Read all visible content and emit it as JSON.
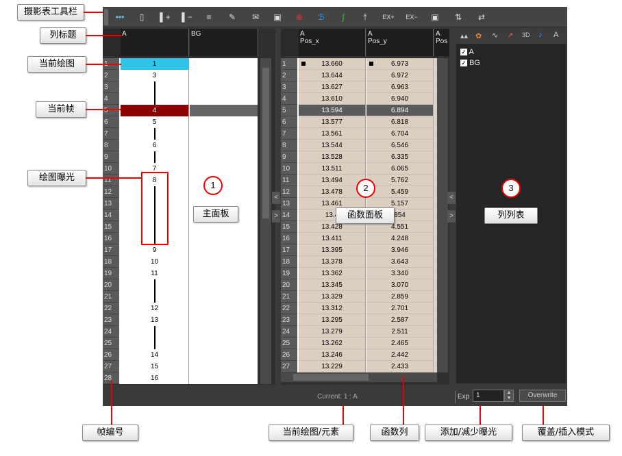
{
  "toolbar": {
    "icons": [
      "more-icon",
      "panel-toggle-icon",
      "add-column-icon",
      "delete-column-icon",
      "insert-frame-icon",
      "edit-drawing-icon",
      "new-drawing-icon",
      "duplicate-icon",
      "target-icon",
      "bezier-icon",
      "ease-icon",
      "stop-motion-icon",
      "ex-plus",
      "ex-minus",
      "text-icon",
      "swap-icon",
      "flip-icon"
    ],
    "ex_plus": "EX+",
    "ex_minus": "EX−"
  },
  "main_panel": {
    "col_a": "A",
    "col_bg": "BG",
    "rows": [
      {
        "n": "1",
        "v": "1"
      },
      {
        "n": "2",
        "v": "3"
      },
      {
        "n": "3",
        "v": ""
      },
      {
        "n": "4",
        "v": ""
      },
      {
        "n": "5",
        "v": "4"
      },
      {
        "n": "6",
        "v": "5"
      },
      {
        "n": "7",
        "v": ""
      },
      {
        "n": "8",
        "v": "6"
      },
      {
        "n": "9",
        "v": ""
      },
      {
        "n": "10",
        "v": "7"
      },
      {
        "n": "11",
        "v": "8"
      },
      {
        "n": "12",
        "v": ""
      },
      {
        "n": "13",
        "v": ""
      },
      {
        "n": "14",
        "v": ""
      },
      {
        "n": "15",
        "v": ""
      },
      {
        "n": "16",
        "v": ""
      },
      {
        "n": "17",
        "v": "9"
      },
      {
        "n": "18",
        "v": "10"
      },
      {
        "n": "19",
        "v": "11"
      },
      {
        "n": "20",
        "v": ""
      },
      {
        "n": "21",
        "v": ""
      },
      {
        "n": "22",
        "v": "12"
      },
      {
        "n": "23",
        "v": "13"
      },
      {
        "n": "24",
        "v": ""
      },
      {
        "n": "25",
        "v": ""
      },
      {
        "n": "26",
        "v": "14"
      },
      {
        "n": "27",
        "v": "15"
      },
      {
        "n": "28",
        "v": "16"
      }
    ]
  },
  "function_panel": {
    "col1_title": "A",
    "col1_sub": "Pos_x",
    "col2_title": "A",
    "col2_sub": "Pos_y",
    "col3_title": "A",
    "col3_sub": "Pos",
    "rows": [
      {
        "n": "1",
        "x": "13.660",
        "y": "6.973"
      },
      {
        "n": "2",
        "x": "13.644",
        "y": "6.972"
      },
      {
        "n": "3",
        "x": "13.627",
        "y": "6.963"
      },
      {
        "n": "4",
        "x": "13.610",
        "y": "6.940"
      },
      {
        "n": "5",
        "x": "13.594",
        "y": "6.894"
      },
      {
        "n": "6",
        "x": "13.577",
        "y": "6.818"
      },
      {
        "n": "7",
        "x": "13.561",
        "y": "6.704"
      },
      {
        "n": "8",
        "x": "13.544",
        "y": "6.546"
      },
      {
        "n": "9",
        "x": "13.528",
        "y": "6.335"
      },
      {
        "n": "10",
        "x": "13.511",
        "y": "6.065"
      },
      {
        "n": "11",
        "x": "13.494",
        "y": "5.762"
      },
      {
        "n": "12",
        "x": "13.478",
        "y": "5.459"
      },
      {
        "n": "13",
        "x": "13.461",
        "y": "5.157"
      },
      {
        "n": "14",
        "x": "13.4",
        "y": "854"
      },
      {
        "n": "15",
        "x": "13.428",
        "y": "4.551"
      },
      {
        "n": "16",
        "x": "13.411",
        "y": "4.248"
      },
      {
        "n": "17",
        "x": "13.395",
        "y": "3.946"
      },
      {
        "n": "18",
        "x": "13.378",
        "y": "3.643"
      },
      {
        "n": "19",
        "x": "13.362",
        "y": "3.340"
      },
      {
        "n": "20",
        "x": "13.345",
        "y": "3.070"
      },
      {
        "n": "21",
        "x": "13.329",
        "y": "2.859"
      },
      {
        "n": "22",
        "x": "13.312",
        "y": "2.701"
      },
      {
        "n": "23",
        "x": "13.295",
        "y": "2.587"
      },
      {
        "n": "24",
        "x": "13.279",
        "y": "2.511"
      },
      {
        "n": "25",
        "x": "13.262",
        "y": "2.465"
      },
      {
        "n": "26",
        "x": "13.246",
        "y": "2.442"
      },
      {
        "n": "27",
        "x": "13.229",
        "y": "2.433"
      }
    ]
  },
  "column_list": {
    "tab_3d": "3D",
    "items": [
      {
        "label": "A",
        "checked": true
      },
      {
        "label": "BG",
        "checked": true
      }
    ]
  },
  "status": {
    "current": "Current: 1 : A",
    "exp_label": "Exp",
    "exp_value": "1",
    "overwrite": "Overwrite"
  },
  "callouts": {
    "toolbar": "摄影表工具栏",
    "col_header": "列标题",
    "current_drawing": "当前绘图",
    "current_frame": "当前帧",
    "exposure": "绘图曝光",
    "main_panel": "主面板",
    "function_panel": "函数面板",
    "column_list": "列列表",
    "frame_number": "帧编号",
    "current_element": "当前绘图/元素",
    "function_column": "函数列",
    "add_reduce": "添加/减少曝光",
    "overwrite_insert": "覆盖/插入模式",
    "n1": "1",
    "n2": "2",
    "n3": "3"
  },
  "colors": {
    "current_drawing": "#2ec6e8",
    "current_frame": "#8b0000",
    "function_cell": "#dccfc0",
    "annotation": "#e00000"
  }
}
